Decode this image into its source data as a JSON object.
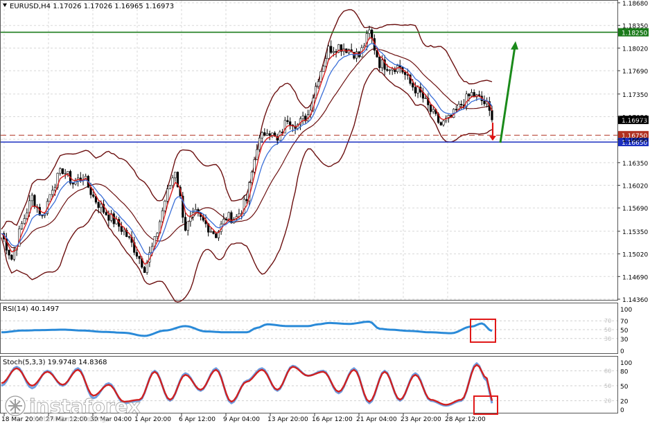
{
  "chart_data": [
    {
      "type": "candlestick",
      "title": "EURUSD,H4 1.17026 1.17026 1.16965 1.16973",
      "symbol": "EURUSD",
      "timeframe": "H4",
      "ylim": [
        1.1436,
        1.1868
      ],
      "y_ticks": [
        "1.18680",
        "1.18350",
        "1.18020",
        "1.17690",
        "1.17350",
        "1.17020",
        "1.16690",
        "1.16350",
        "1.16020",
        "1.15690",
        "1.15350",
        "1.15020",
        "1.14690",
        "1.14360"
      ],
      "x_ticks": [
        "18 Mar 20:00",
        "27 Mar 12:00",
        "30 Mar 04:00",
        "1 Apr 20:00",
        "6 Apr 12:00",
        "9 Apr 04:00",
        "13 Apr 20:00",
        "16 Apr 12:00",
        "21 Apr 04:00",
        "23 Apr 20:00",
        "28 Apr 12:00"
      ],
      "levels": [
        {
          "label": "1.18250",
          "value": 1.1825,
          "color": "#1a7a1a",
          "style": "solid"
        },
        {
          "label": "1.16750",
          "value": 1.1675,
          "color": "#b03020",
          "style": "dashed"
        },
        {
          "label": "1.16650",
          "value": 1.1665,
          "color": "#1a2fc0",
          "style": "solid"
        }
      ],
      "current_price": {
        "label": "1.16973",
        "value": 1.16973
      },
      "price_path": [
        [
          0,
          1.1532
        ],
        [
          4,
          1.1495
        ],
        [
          8,
          1.1545
        ],
        [
          12,
          1.1585
        ],
        [
          16,
          1.1555
        ],
        [
          20,
          1.16
        ],
        [
          24,
          1.1625
        ],
        [
          28,
          1.1605
        ],
        [
          32,
          1.1615
        ],
        [
          36,
          1.1585
        ],
        [
          40,
          1.1565
        ],
        [
          44,
          1.155
        ],
        [
          48,
          1.1535
        ],
        [
          52,
          1.151
        ],
        [
          56,
          1.1482
        ],
        [
          60,
          1.152
        ],
        [
          64,
          1.158
        ],
        [
          68,
          1.1625
        ],
        [
          72,
          1.154
        ],
        [
          76,
          1.156
        ],
        [
          80,
          1.1545
        ],
        [
          84,
          1.153
        ],
        [
          88,
          1.1555
        ],
        [
          92,
          1.1555
        ],
        [
          96,
          1.158
        ],
        [
          100,
          1.166
        ],
        [
          104,
          1.1685
        ],
        [
          108,
          1.1665
        ],
        [
          112,
          1.17
        ],
        [
          116,
          1.169
        ],
        [
          120,
          1.1705
        ],
        [
          124,
          1.176
        ],
        [
          128,
          1.18
        ],
        [
          132,
          1.1805
        ],
        [
          136,
          1.18
        ],
        [
          140,
          1.179
        ],
        [
          144,
          1.1825
        ],
        [
          148,
          1.178
        ],
        [
          152,
          1.1775
        ],
        [
          156,
          1.1775
        ],
        [
          160,
          1.175
        ],
        [
          164,
          1.1735
        ],
        [
          168,
          1.171
        ],
        [
          172,
          1.169
        ],
        [
          176,
          1.17
        ],
        [
          180,
          1.172
        ],
        [
          184,
          1.1735
        ],
        [
          188,
          1.1725
        ],
        [
          190,
          1.1718
        ],
        [
          192,
          1.1697
        ]
      ],
      "overlays": [
        "Bollinger Bands",
        "moving average (red)",
        "moving average (blue)"
      ],
      "arrows": [
        {
          "direction": "down",
          "color": "#dd1111"
        },
        {
          "direction": "up",
          "color": "#1a8a1a"
        }
      ]
    },
    {
      "type": "line",
      "title": "RSI(14) 40.1497",
      "ylim": [
        0,
        100
      ],
      "levels": [
        70,
        50,
        30
      ],
      "y_ticks": [
        "100",
        "70",
        "50",
        "30",
        "0"
      ],
      "series": [
        {
          "name": "",
          "color": "#2a8ad8",
          "x": [
            0,
            8,
            16,
            24,
            32,
            40,
            48,
            56,
            64,
            72,
            80,
            88,
            96,
            100,
            104,
            112,
            120,
            124,
            128,
            136,
            144,
            148,
            152,
            160,
            168,
            176,
            184,
            188,
            192
          ],
          "values": [
            44,
            48,
            49,
            50,
            48,
            45,
            43,
            36,
            48,
            58,
            46,
            44,
            44,
            54,
            62,
            58,
            58,
            62,
            65,
            63,
            68,
            52,
            50,
            47,
            44,
            42,
            57,
            64,
            47
          ]
        }
      ]
    },
    {
      "type": "line",
      "title": "Stoch(5,3,3) 19.9748 14.8368",
      "ylim": [
        0,
        100
      ],
      "levels": [
        80,
        50,
        20
      ],
      "y_ticks": [
        "100",
        "80",
        "50",
        "20",
        "0"
      ],
      "series": [
        {
          "name": "",
          "color": "#6f9ee0",
          "x": [
            0,
            6,
            12,
            18,
            24,
            30,
            36,
            42,
            48,
            54,
            60,
            66,
            72,
            78,
            84,
            90,
            96,
            102,
            108,
            114,
            120,
            126,
            132,
            138,
            144,
            150,
            156,
            162,
            168,
            174,
            180,
            186,
            190,
            192
          ],
          "values": [
            50,
            88,
            45,
            80,
            50,
            85,
            25,
            55,
            15,
            20,
            80,
            20,
            75,
            40,
            85,
            15,
            60,
            85,
            40,
            90,
            70,
            80,
            35,
            85,
            15,
            80,
            20,
            75,
            20,
            10,
            20,
            95,
            60,
            14.8
          ]
        },
        {
          "name": "",
          "color": "#d02020",
          "x": [
            0,
            6,
            12,
            18,
            24,
            30,
            36,
            42,
            48,
            54,
            60,
            66,
            72,
            78,
            84,
            90,
            96,
            102,
            108,
            114,
            120,
            126,
            132,
            138,
            144,
            150,
            156,
            162,
            168,
            174,
            180,
            186,
            190,
            192
          ],
          "values": [
            55,
            85,
            50,
            78,
            52,
            82,
            30,
            52,
            18,
            22,
            78,
            22,
            72,
            42,
            82,
            18,
            58,
            82,
            42,
            88,
            70,
            78,
            38,
            82,
            18,
            78,
            22,
            72,
            22,
            12,
            22,
            92,
            65,
            20
          ]
        }
      ]
    }
  ],
  "annotations": {
    "watermark": "instaforex",
    "watermark_sub": "Instant Forex Trading"
  }
}
